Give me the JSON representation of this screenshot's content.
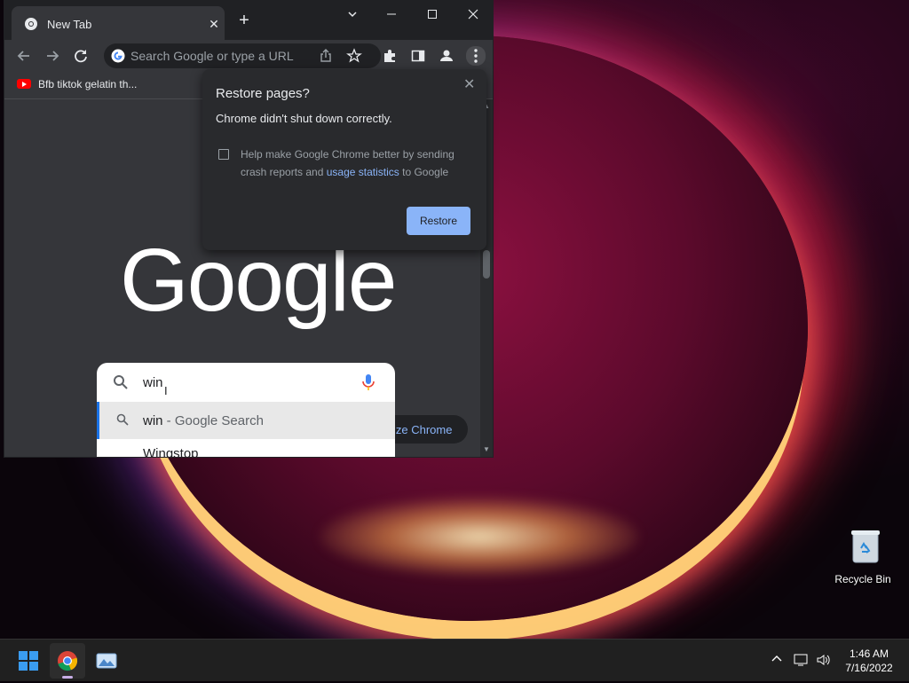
{
  "browser": {
    "tab_title": "New Tab",
    "omnibox_placeholder": "Search Google or type a URL",
    "bookmark_label": "Bfb tiktok gelatin th...",
    "logo_text": "Google",
    "customize_label": "ize Chrome"
  },
  "popup": {
    "title": "Restore pages?",
    "message": "Chrome didn't shut down correctly.",
    "help_text": "Help make Google Chrome better by sending crash reports and",
    "help_link": "usage statistics",
    "help_suffix": "to Google",
    "restore_label": "Restore"
  },
  "search": {
    "query": "win",
    "suggestion_1_main": "win",
    "suggestion_1_suffix": " - Google Search",
    "suggestion_2": "Wingstop"
  },
  "desktop": {
    "recycle_label": "Recycle Bin"
  },
  "taskbar": {
    "time": "1:46 AM",
    "date": "7/16/2022"
  },
  "colors": {
    "accent": "#8ab4f8",
    "browser_bg": "#35363a",
    "tabstrip_bg": "#202124",
    "taskbar_bg": "#202020"
  }
}
